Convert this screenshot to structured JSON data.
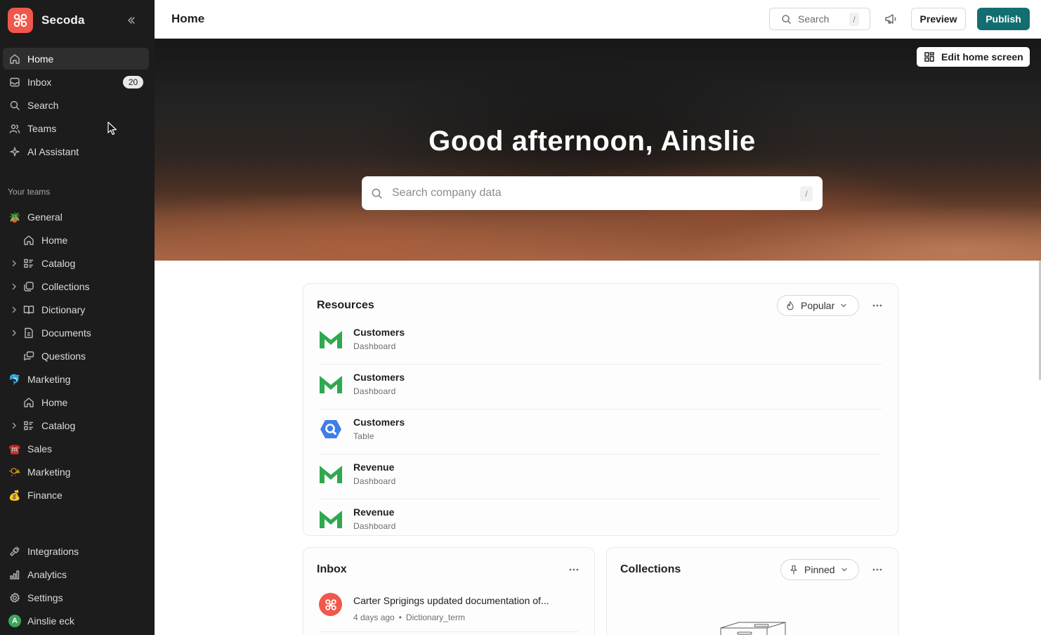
{
  "app": {
    "name": "Secoda",
    "brand_color": "#f0584b",
    "accent_color": "#136e72"
  },
  "sidebar": {
    "collapse_icon": "double-chevron-left-icon",
    "primary": [
      {
        "label": "Home",
        "icon": "home-icon",
        "active": true
      },
      {
        "label": "Inbox",
        "icon": "inbox-icon",
        "badge": "20"
      },
      {
        "label": "Search",
        "icon": "search-icon"
      },
      {
        "label": "Teams",
        "icon": "users-icon"
      },
      {
        "label": "AI Assistant",
        "icon": "sparkles-icon"
      }
    ],
    "teams_heading": "Your teams",
    "teams": [
      {
        "label": "General",
        "emoji": "🪴"
      },
      {
        "label": "Home",
        "icon": "home-icon"
      },
      {
        "label": "Catalog",
        "icon": "catalog-icon"
      },
      {
        "label": "Collections",
        "icon": "collections-icon"
      },
      {
        "label": "Dictionary",
        "icon": "book-icon"
      },
      {
        "label": "Documents",
        "icon": "document-icon"
      },
      {
        "label": "Questions",
        "icon": "questions-icon"
      },
      {
        "label": "Marketing",
        "emoji": "🐬"
      },
      {
        "label": "Home",
        "icon": "home-icon"
      },
      {
        "label": "Catalog",
        "icon": "catalog-icon"
      },
      {
        "label": "Sales",
        "emoji": "☎️"
      },
      {
        "label": "Marketing",
        "emoji": "📯"
      },
      {
        "label": "Finance",
        "emoji": "💰"
      }
    ],
    "bottom": [
      {
        "label": "Integrations",
        "icon": "plug-icon"
      },
      {
        "label": "Analytics",
        "icon": "bar-chart-icon"
      },
      {
        "label": "Settings",
        "icon": "gear-icon"
      },
      {
        "label": "Ainslie eck",
        "avatar_letter": "A",
        "avatar_color": "#3ca55c"
      }
    ]
  },
  "topbar": {
    "title": "Home",
    "search_label": "Search",
    "search_shortcut": "/",
    "preview_label": "Preview",
    "publish_label": "Publish"
  },
  "hero": {
    "edit_label": "Edit home screen",
    "greeting": "Good afternoon, Ainslie",
    "search_placeholder": "Search company data",
    "search_shortcut": "/"
  },
  "resources": {
    "title": "Resources",
    "filter_label": "Popular",
    "items": [
      {
        "title": "Customers",
        "subtitle": "Dashboard",
        "icon": "metabase-icon"
      },
      {
        "title": "Customers",
        "subtitle": "Dashboard",
        "icon": "metabase-icon"
      },
      {
        "title": "Customers",
        "subtitle": "Table",
        "icon": "bigquery-icon"
      },
      {
        "title": "Revenue",
        "subtitle": "Dashboard",
        "icon": "metabase-icon"
      },
      {
        "title": "Revenue",
        "subtitle": "Dashboard",
        "icon": "metabase-icon"
      }
    ]
  },
  "inbox": {
    "title": "Inbox",
    "items": [
      {
        "text": "Carter Sprigings updated documentation of...",
        "time": "4 days ago",
        "entity": "Dictionary_term"
      }
    ]
  },
  "collections": {
    "title": "Collections",
    "filter_label": "Pinned"
  }
}
